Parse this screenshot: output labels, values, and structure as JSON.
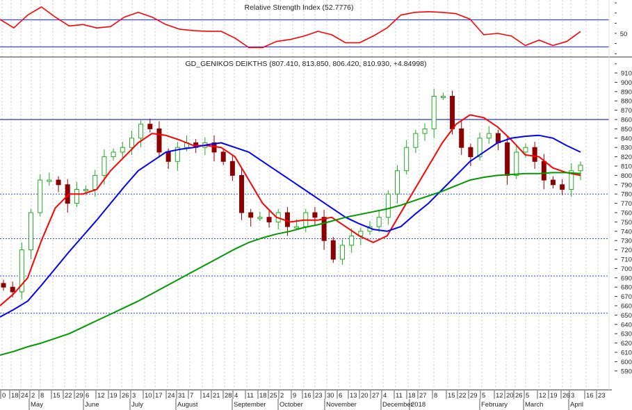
{
  "chart_data": [
    {
      "type": "line",
      "title": "Relative Strength Index (52.7776)",
      "ylim": [
        0,
        100
      ],
      "levels": [
        70,
        30
      ],
      "yticks": [
        "50"
      ],
      "series": [
        {
          "name": "RSI",
          "color": "#ff0000",
          "values": [
            70.6,
            58,
            77,
            89,
            74,
            61,
            63,
            58,
            60,
            74,
            81,
            74,
            63,
            56,
            54,
            53,
            53,
            43,
            29,
            29,
            38,
            41,
            46,
            53,
            48,
            36,
            36,
            46,
            58,
            77,
            81,
            82,
            81,
            79,
            71,
            48,
            50,
            46,
            32,
            40,
            32,
            38,
            52.8
          ]
        }
      ]
    },
    {
      "type": "candlestick",
      "title": "GD_GENIKOS DEIKTHS (807.410, 813.850, 806.420, 810.930, +4.84998)",
      "ylim": [
        583,
        915
      ],
      "yticks": [
        "910",
        "900",
        "890",
        "880",
        "870",
        "860",
        "850",
        "840",
        "830",
        "820",
        "810",
        "800",
        "790",
        "780",
        "770",
        "760",
        "750",
        "740",
        "730",
        "720",
        "710",
        "700",
        "690",
        "680",
        "670",
        "660",
        "650",
        "640",
        "630",
        "620",
        "610",
        "600",
        "590"
      ],
      "horizontal_solid_level": 860,
      "horizontal_dotted_levels": [
        780,
        732,
        692,
        652
      ],
      "closes": [
        680,
        675,
        720,
        760,
        795,
        795,
        790,
        770,
        785,
        785,
        800,
        820,
        825,
        830,
        840,
        855,
        850,
        825,
        815,
        830,
        835,
        830,
        835,
        825,
        815,
        800,
        760,
        755,
        755,
        750,
        760,
        745,
        745,
        760,
        755,
        730,
        710,
        725,
        735,
        740,
        745,
        755,
        780,
        805,
        830,
        845,
        850,
        885,
        885,
        850,
        830,
        820,
        840,
        845,
        835,
        800,
        825,
        830,
        815,
        795,
        790,
        785,
        805,
        810.93
      ],
      "colors": {
        "up": "#22aa22",
        "down": "#8b0000"
      },
      "series": [
        {
          "name": "MA short",
          "color": "#ff0000",
          "values": [
            660,
            673,
            690,
            730,
            765,
            780,
            780,
            785,
            805,
            820,
            835,
            845,
            843,
            838,
            832,
            832,
            830,
            820,
            795,
            770,
            755,
            750,
            752,
            752,
            755,
            745,
            735,
            728,
            735,
            760,
            785,
            810,
            835,
            855,
            865,
            862,
            852,
            838,
            822,
            820,
            808,
            803,
            800
          ]
        },
        {
          "name": "MA medium",
          "color": "#0000ff",
          "values": [
            648,
            656,
            665,
            682,
            700,
            718,
            735,
            752,
            770,
            788,
            805,
            815,
            825,
            828,
            830,
            833,
            835,
            830,
            825,
            815,
            805,
            795,
            785,
            775,
            765,
            755,
            748,
            742,
            740,
            745,
            758,
            770,
            785,
            800,
            815,
            825,
            835,
            840,
            842,
            843,
            840,
            832,
            825
          ]
        },
        {
          "name": "MA long",
          "color": "#009900",
          "values": [
            607,
            611,
            616,
            620,
            625,
            630,
            637,
            644,
            651,
            658,
            665,
            673,
            681,
            689,
            697,
            705,
            713,
            721,
            728,
            733,
            737,
            740,
            744,
            747,
            751,
            755,
            758,
            761,
            764,
            768,
            773,
            778,
            783,
            789,
            795,
            798,
            800,
            801,
            802,
            802,
            803,
            803,
            802
          ]
        }
      ],
      "x_day_ticks": [
        "0",
        "18",
        "24",
        "2",
        "8",
        "15",
        "22",
        "29",
        "6",
        "12",
        "19",
        "26",
        "3",
        "10",
        "17",
        "24",
        "31",
        "7",
        "14",
        "21",
        "28",
        "4",
        "11",
        "18",
        "25",
        "2",
        "9",
        "16",
        "23",
        "30",
        "6",
        "13",
        "20",
        "27",
        "4",
        "11",
        "18",
        "27",
        "8",
        "15",
        "22",
        "29",
        "5",
        "12",
        "20",
        "26",
        "5",
        "12",
        "19",
        "26",
        "3",
        "16",
        "23"
      ],
      "x_months": [
        {
          "label": "May",
          "tick": 3
        },
        {
          "label": "June",
          "tick": 8
        },
        {
          "label": "July",
          "tick": 12
        },
        {
          "label": "August",
          "tick": 16
        },
        {
          "label": "September",
          "tick": 21
        },
        {
          "label": "October",
          "tick": 25
        },
        {
          "label": "November",
          "tick": 29
        },
        {
          "label": "December",
          "tick": 34
        },
        {
          "label": "2018",
          "tick": 37
        },
        {
          "label": "February",
          "tick": 42
        },
        {
          "label": "March",
          "tick": 46
        },
        {
          "label": "April",
          "tick": 50
        }
      ]
    }
  ]
}
